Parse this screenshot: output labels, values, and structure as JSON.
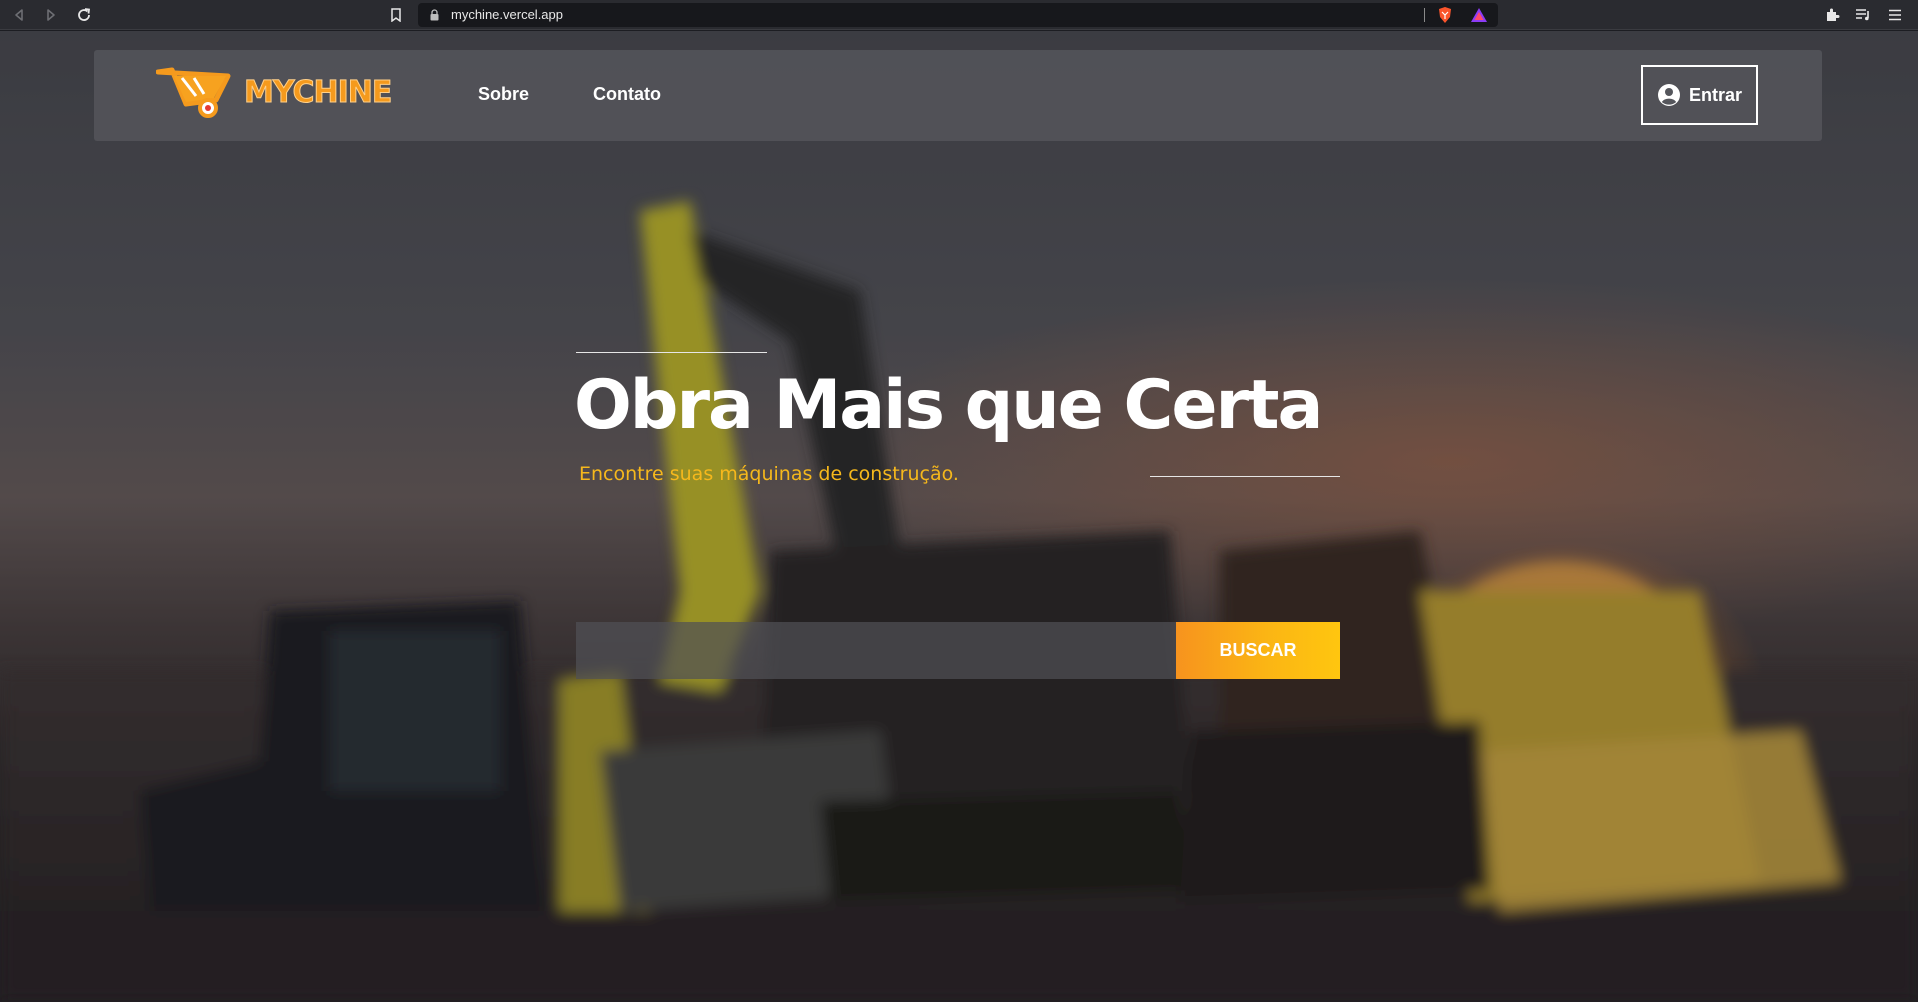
{
  "browser": {
    "url": "mychine.vercel.app",
    "icons": [
      "back-icon",
      "forward-icon",
      "reload-icon",
      "bookmark-icon",
      "lock-icon",
      "brave-shield-icon",
      "brave-rewards-icon",
      "extensions-icon",
      "playlist-icon",
      "menu-icon"
    ]
  },
  "navbar": {
    "logo_text": "MYCHINE",
    "links": [
      {
        "label": "Sobre"
      },
      {
        "label": "Contato"
      }
    ],
    "login_label": "Entrar",
    "login_icon": "user-circle-icon"
  },
  "hero": {
    "title": "Obra Mais que Certa",
    "subtitle": "Encontre suas máquinas de construção.",
    "title_color": "#ffffff",
    "subtitle_color": "#f6b81c"
  },
  "search": {
    "value": "",
    "placeholder": "",
    "button_label": "BUSCAR",
    "button_colors": [
      "#f7931e",
      "#ffc60f"
    ]
  },
  "colors": {
    "brand_orange": "#f59a1d",
    "navbar_bg": "#55565c",
    "browser_bar": "#2a2b30"
  }
}
